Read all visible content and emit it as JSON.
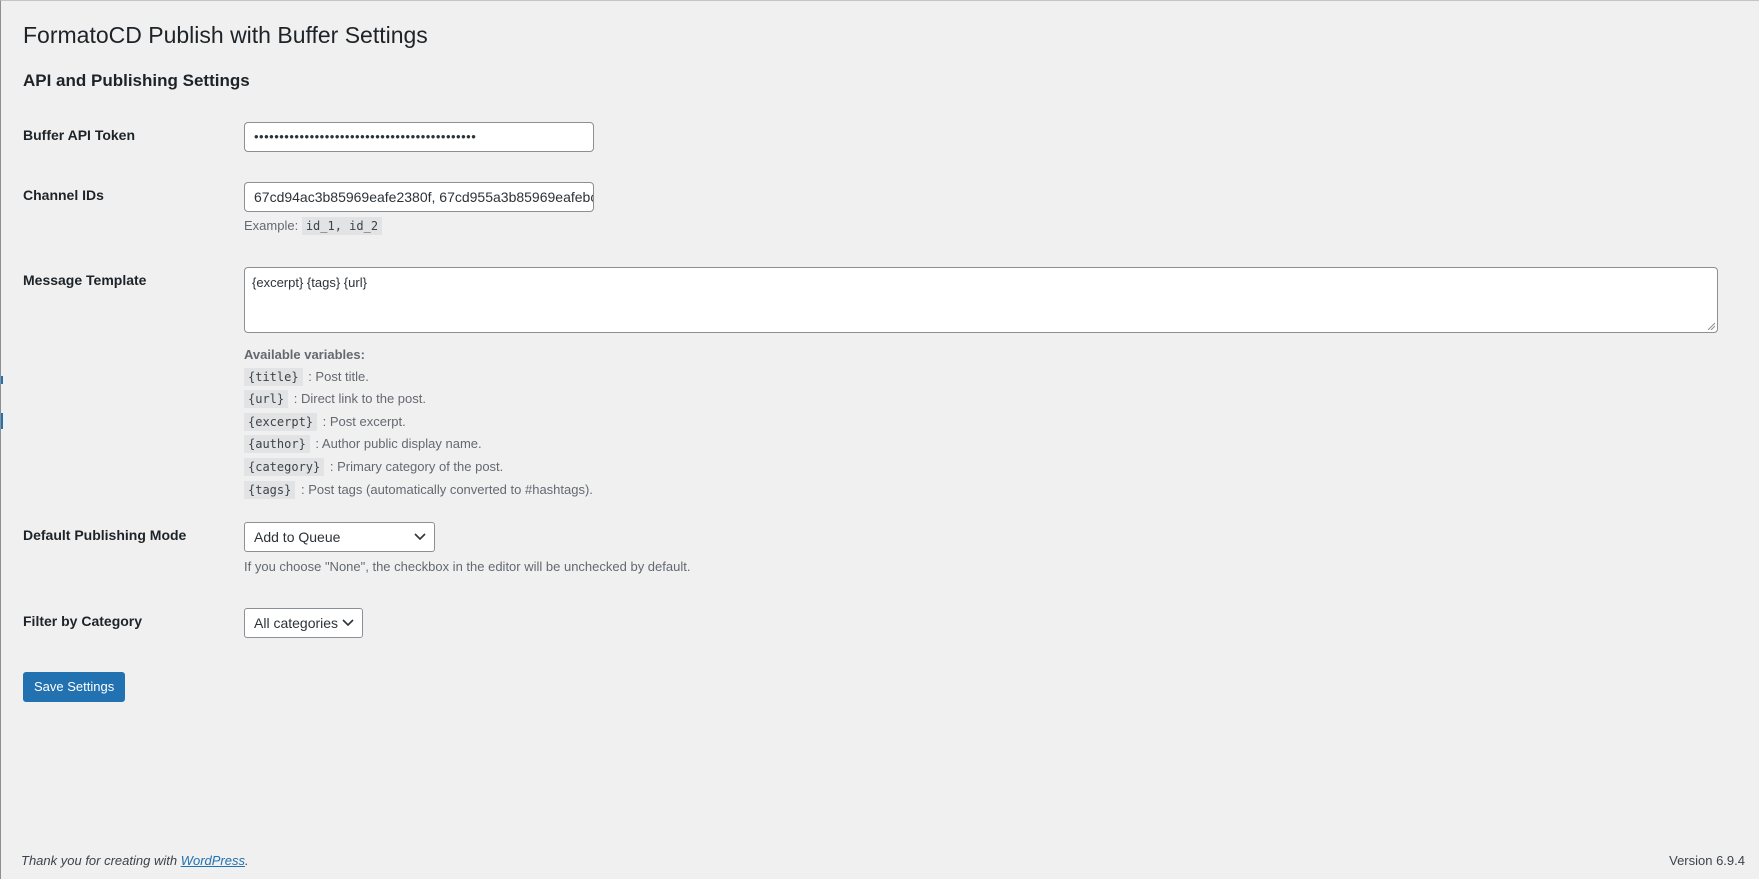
{
  "page": {
    "title": "FormatoCD Publish with Buffer Settings",
    "section_title": "API and Publishing Settings"
  },
  "fields": {
    "api_token": {
      "label": "Buffer API Token",
      "value": "••••••••••••••••••••••••••••••••••••••••••••"
    },
    "channel_ids": {
      "label": "Channel IDs",
      "value": "67cd94ac3b85969eafe2380f, 67cd955a3b85969eafebc",
      "example_prefix": "Example:",
      "example_code": "id_1, id_2"
    },
    "message_template": {
      "label": "Message Template",
      "value": "{excerpt} {tags} {url}",
      "variables_heading": "Available variables:",
      "variables": [
        {
          "code": "{title}",
          "desc": ": Post title."
        },
        {
          "code": "{url}",
          "desc": ": Direct link to the post."
        },
        {
          "code": "{excerpt}",
          "desc": ": Post excerpt."
        },
        {
          "code": "{author}",
          "desc": ": Author public display name."
        },
        {
          "code": "{category}",
          "desc": ": Primary category of the post."
        },
        {
          "code": "{tags}",
          "desc": ": Post tags (automatically converted to #hashtags)."
        }
      ]
    },
    "publishing_mode": {
      "label": "Default Publishing Mode",
      "selected": "Add to Queue",
      "description": "If you choose \"None\", the checkbox in the editor will be unchecked by default."
    },
    "category_filter": {
      "label": "Filter by Category",
      "selected": "All categories"
    }
  },
  "save_label": "Save Settings",
  "footer": {
    "thanks_prefix": "Thank you for creating with ",
    "link_text": "WordPress",
    "thanks_suffix": ".",
    "version": "Version 6.9.4"
  },
  "colors": {
    "background": "#f0f0f1",
    "primary": "#2271b1",
    "text": "#1d2327",
    "description": "#646970"
  },
  "icons": {
    "select_arrow": "chevron-down-icon",
    "textarea_resize": "resize-grip-icon"
  }
}
